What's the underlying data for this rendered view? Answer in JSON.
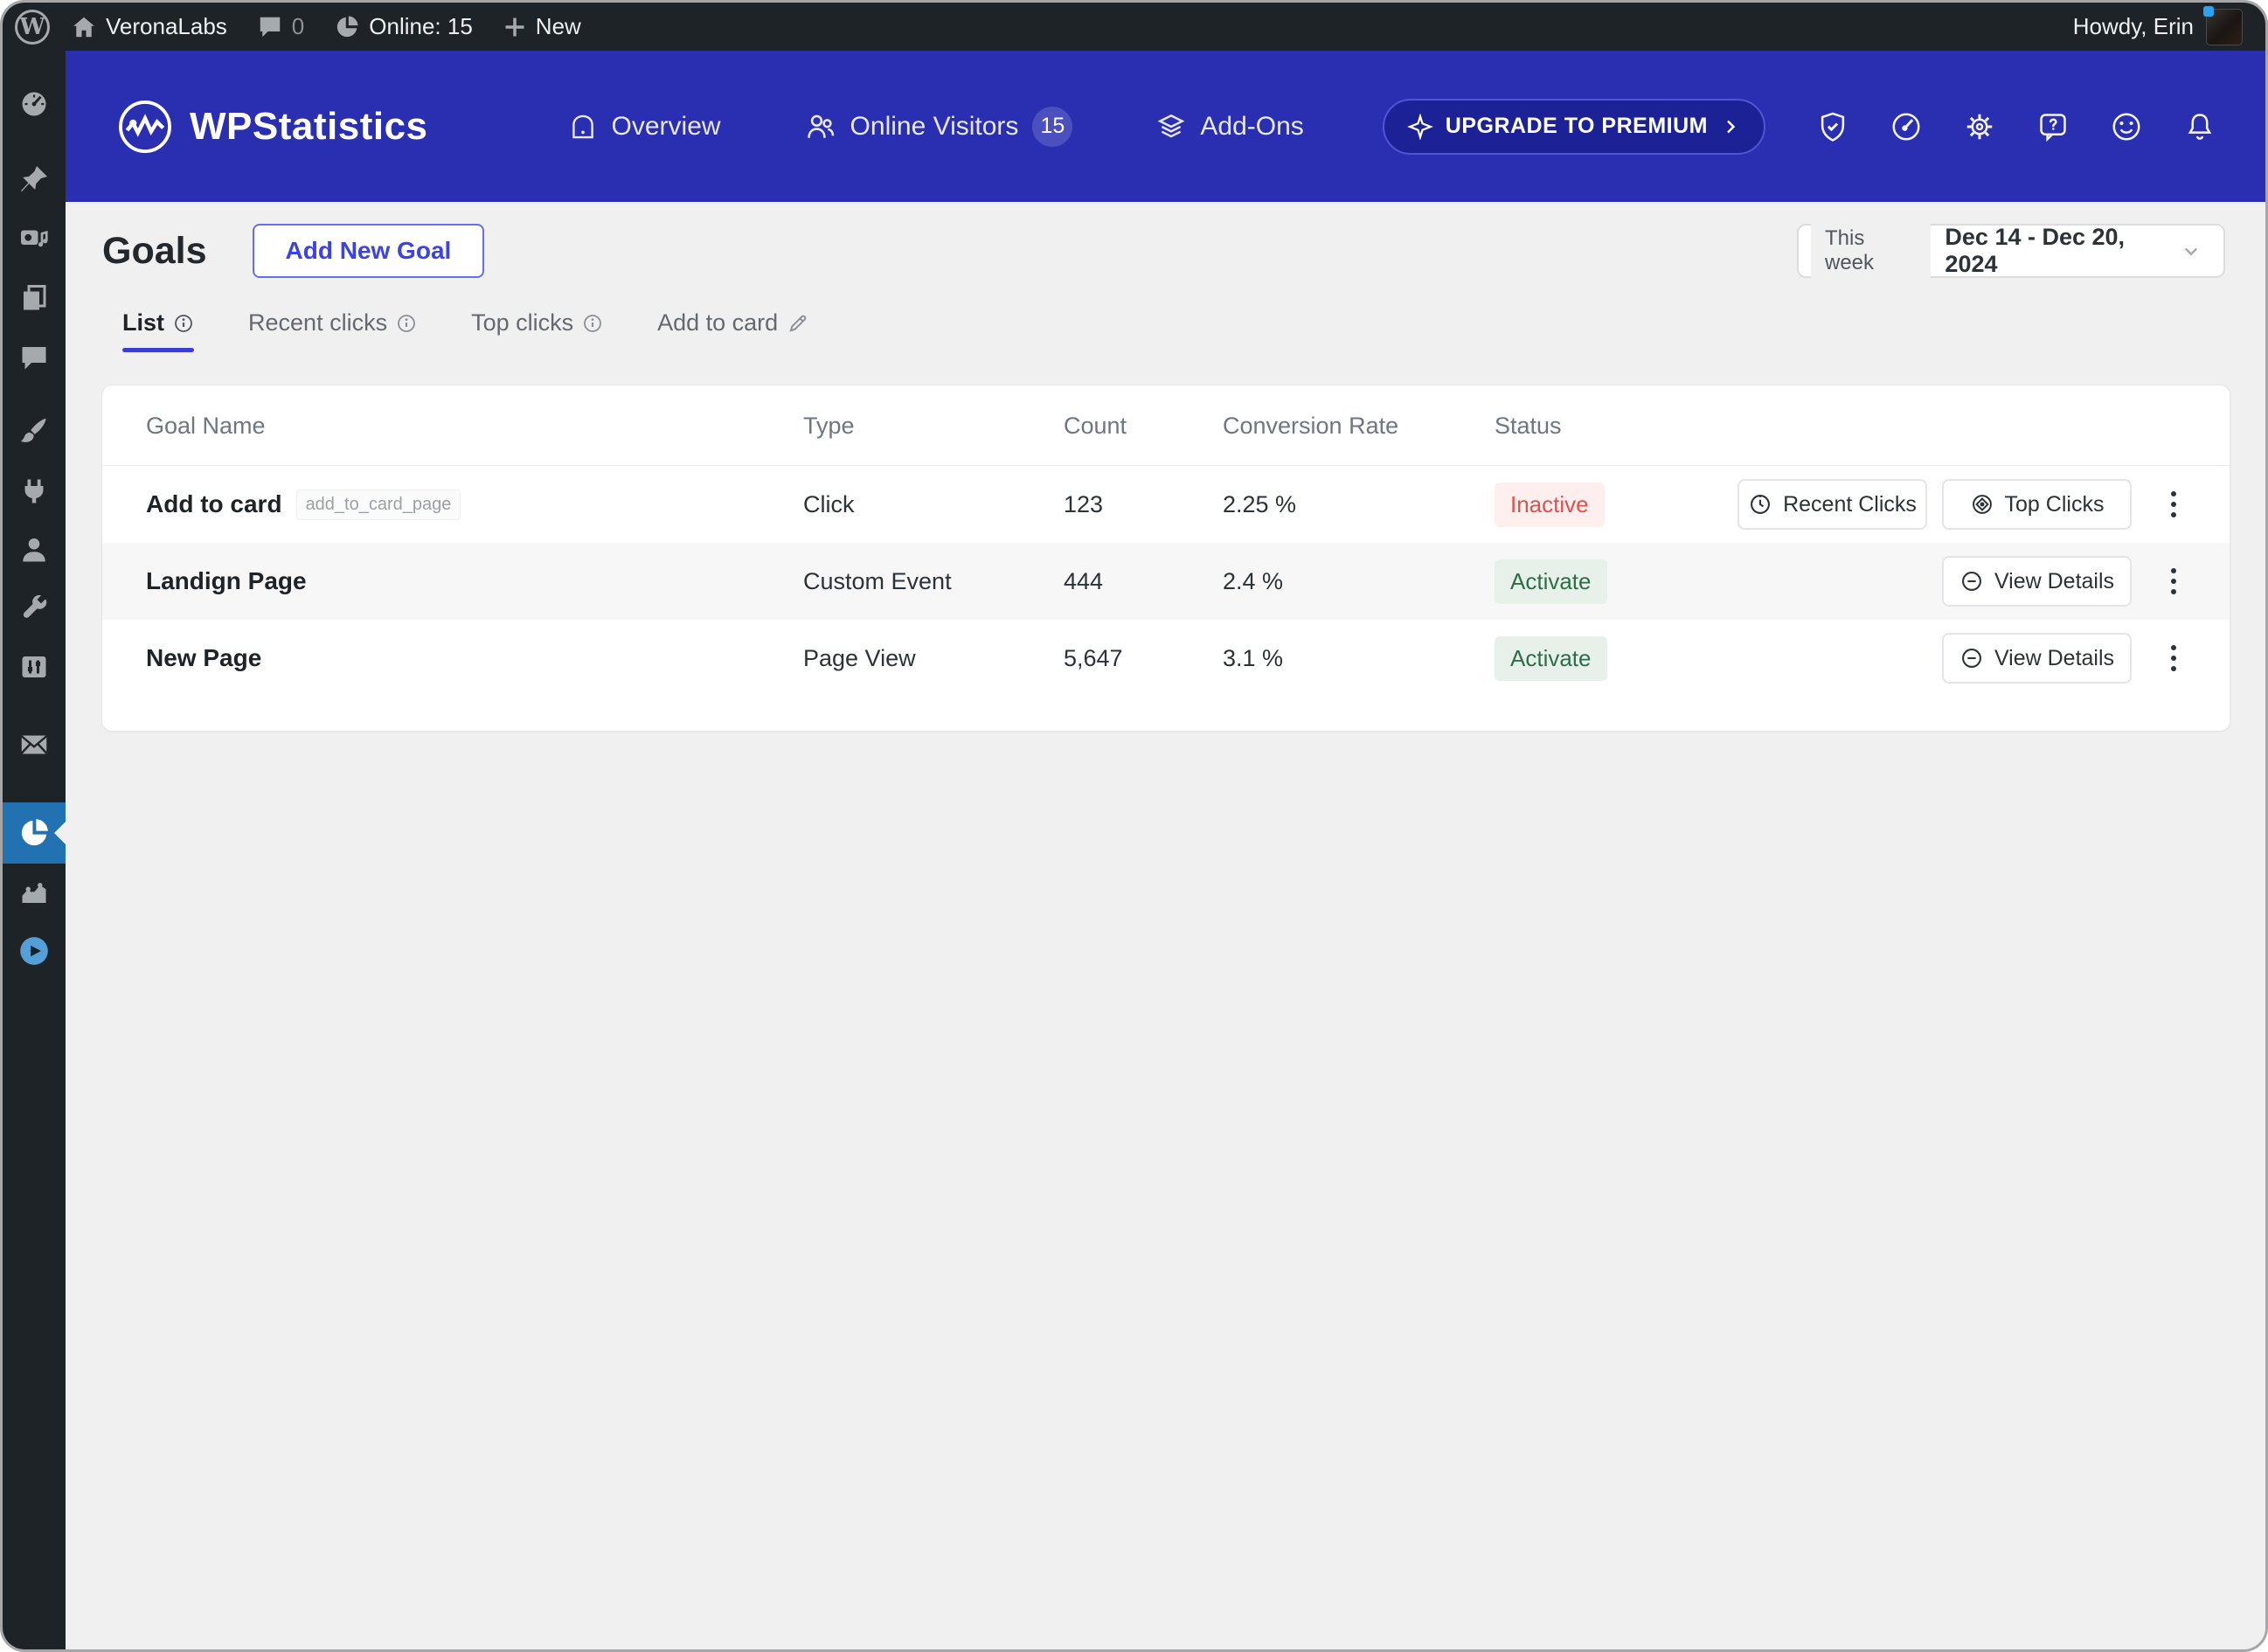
{
  "admin_bar": {
    "site_name": "VeronaLabs",
    "comments_count": "0",
    "online_label": "Online: 15",
    "new_label": "New",
    "howdy": "Howdy, Erin",
    "icons": [
      "wordpress-logo-icon",
      "home-icon",
      "comment-icon",
      "pie-chart-icon",
      "plus-icon",
      "avatar"
    ]
  },
  "sidebar": {
    "active_item": "statistics",
    "items": [
      {
        "icon": "dashboard-icon"
      },
      {
        "icon": "pin-icon"
      },
      {
        "icon": "media-icon"
      },
      {
        "icon": "pages-icon"
      },
      {
        "icon": "comments-icon"
      },
      {
        "icon": "appearance-icon"
      },
      {
        "icon": "plugins-icon"
      },
      {
        "icon": "users-icon"
      },
      {
        "icon": "tools-icon"
      },
      {
        "icon": "settings-icon"
      },
      {
        "icon": "mail-icon"
      },
      {
        "icon": "statistics-pie-icon"
      },
      {
        "icon": "charts-icon"
      },
      {
        "icon": "video-icon"
      }
    ]
  },
  "header": {
    "brand": "WPStatistics",
    "nav": [
      {
        "label": "Overview",
        "icon": "home-icon"
      },
      {
        "label": "Online Visitors",
        "icon": "visitors-icon",
        "badge": "15"
      },
      {
        "label": "Add-Ons",
        "icon": "layers-icon"
      }
    ],
    "upgrade_label": "UPGRADE TO PREMIUM",
    "action_icons": [
      "shield-check-icon",
      "gauge-icon",
      "gear-icon",
      "help-icon",
      "smiley-icon",
      "bell-icon"
    ],
    "colors": {
      "header_bg": "#2a2fb2",
      "upgrade_bg": "#1c2295"
    }
  },
  "page": {
    "title": "Goals",
    "add_button": "Add New Goal",
    "date_range_label": "This week",
    "date_range": "Dec 14 - Dec 20, 2024",
    "tabs": [
      {
        "label": "List",
        "icon": "info-icon",
        "active": true
      },
      {
        "label": "Recent clicks",
        "icon": "info-icon"
      },
      {
        "label": "Top clicks",
        "icon": "info-icon"
      },
      {
        "label": "Add to card",
        "icon": "pencil-icon"
      }
    ]
  },
  "table": {
    "columns": [
      "Goal Name",
      "Type",
      "Count",
      "Conversion Rate",
      "Status"
    ],
    "rows": [
      {
        "name": "Add to card",
        "tag": "add_to_card_page",
        "type": "Click",
        "count": "123",
        "conversion": "2.25 %",
        "status": "Inactive",
        "status_kind": "inactive",
        "actions": [
          "Recent Clicks",
          "Top Clicks"
        ]
      },
      {
        "name": "Landign Page",
        "type": "Custom Event",
        "count": "444",
        "conversion": "2.4 %",
        "status": "Activate",
        "status_kind": "active",
        "actions": [
          "View Details"
        ]
      },
      {
        "name": "New Page",
        "type": "Page View",
        "count": "5,647",
        "conversion": "3.1 %",
        "status": "Activate",
        "status_kind": "active",
        "actions": [
          "View Details"
        ]
      }
    ]
  },
  "colors": {
    "accent_blue": "#3a43ea",
    "tab_underline": "#3a3fd2",
    "active_menu": "#2271b1",
    "inactive_red": "#e0514c",
    "active_green": "#2c6e49",
    "admin_dark": "#1d2327"
  }
}
